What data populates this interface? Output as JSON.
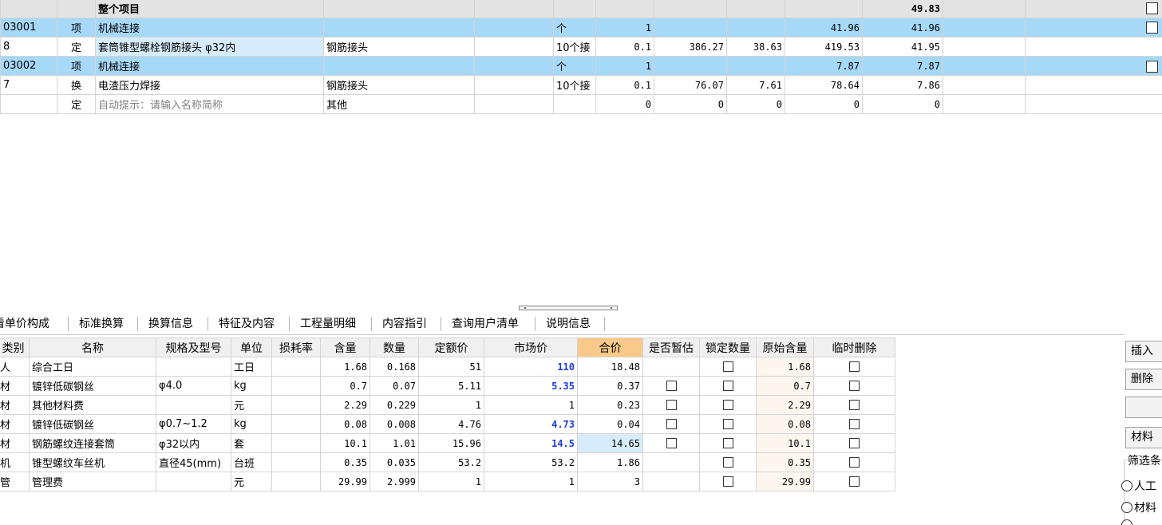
{
  "top": {
    "rows": [
      {
        "code": "",
        "type": "",
        "name": "整个项目",
        "kind": "header",
        "total": "49.83"
      },
      {
        "code": "03001",
        "type": "项",
        "name": "机械连接",
        "kind": "hl",
        "unit": "个",
        "qty": "1",
        "total": "41.96",
        "sum": "41.96"
      },
      {
        "code": "8",
        "type": "定",
        "name": "套筒锥型螺栓钢筋接头 φ32内",
        "spec": "钢筋接头",
        "kind": "plain",
        "unit": "10个接",
        "qty": "0.1",
        "p1": "386.27",
        "p2": "38.63",
        "total": "419.53",
        "sum": "41.95"
      },
      {
        "code": "03002",
        "type": "项",
        "name": "机械连接",
        "kind": "hl",
        "unit": "个",
        "qty": "1",
        "total": "7.87",
        "sum": "7.87"
      },
      {
        "code": "7",
        "type": "换",
        "name": "电渣压力焊接",
        "spec": "钢筋接头",
        "kind": "plain",
        "unit": "10个接",
        "qty": "0.1",
        "p1": "76.07",
        "p2": "7.61",
        "total": "78.64",
        "sum": "7.86"
      },
      {
        "code": "",
        "type": "定",
        "name": "自动提示：请输入名称简称",
        "spec": "其他",
        "kind": "hint",
        "unit": "",
        "qty": "0",
        "p1": "0",
        "p2": "0",
        "total": "0",
        "sum": "0"
      }
    ]
  },
  "tabs": [
    "看单价构成",
    "标准换算",
    "换算信息",
    "特征及内容",
    "工程量明细",
    "内容指引",
    "查询用户清单",
    "说明信息"
  ],
  "bottom": {
    "headers": [
      "类别",
      "名称",
      "规格及型号",
      "单位",
      "损耗率",
      "含量",
      "数量",
      "定额价",
      "市场价",
      "合价",
      "是否暂估",
      "锁定数量",
      "原始含量",
      "临时删除"
    ],
    "rows": [
      {
        "cat": "人",
        "name": "综合工日",
        "spec": "",
        "unit": "工日",
        "loss": "",
        "content": "1.68",
        "qty": "0.168",
        "quota": "51",
        "market": "110",
        "market_blue": true,
        "sum": "18.48",
        "est": false,
        "orig": "1.68"
      },
      {
        "cat": "材",
        "name": "镀锌低碳钢丝",
        "spec": "φ4.0",
        "unit": "kg",
        "loss": "",
        "content": "0.7",
        "qty": "0.07",
        "quota": "5.11",
        "market": "5.35",
        "market_blue": true,
        "sum": "0.37",
        "est": true,
        "orig": "0.7"
      },
      {
        "cat": "材",
        "name": "其他材料费",
        "spec": "",
        "unit": "元",
        "loss": "",
        "content": "2.29",
        "qty": "0.229",
        "quota": "1",
        "market": "1",
        "market_blue": false,
        "sum": "0.23",
        "est": true,
        "orig": "2.29"
      },
      {
        "cat": "材",
        "name": "镀锌低碳钢丝",
        "spec": "φ0.7~1.2",
        "unit": "kg",
        "loss": "",
        "content": "0.08",
        "qty": "0.008",
        "quota": "4.76",
        "market": "4.73",
        "market_blue": true,
        "sum": "0.04",
        "est": true,
        "orig": "0.08"
      },
      {
        "cat": "材",
        "name": "钢筋螺纹连接套筒",
        "spec": "φ32以内",
        "unit": "套",
        "loss": "",
        "content": "10.1",
        "qty": "1.01",
        "quota": "15.96",
        "market": "14.5",
        "market_blue": true,
        "sum": "14.65",
        "est": true,
        "orig": "10.1",
        "selected": true
      },
      {
        "cat": "机",
        "name": "锥型螺纹车丝机",
        "spec": "直径45(mm)",
        "unit": "台班",
        "loss": "",
        "content": "0.35",
        "qty": "0.035",
        "quota": "53.2",
        "market": "53.2",
        "market_blue": false,
        "sum": "1.86",
        "est": false,
        "orig": "0.35"
      },
      {
        "cat": "管",
        "name": "管理费",
        "spec": "",
        "unit": "元",
        "loss": "",
        "content": "29.99",
        "qty": "2.999",
        "quota": "1",
        "market": "1",
        "market_blue": false,
        "sum": "3",
        "est": false,
        "orig": "29.99"
      }
    ]
  },
  "right": {
    "insert": "插入",
    "delete": "删除",
    "blank": "",
    "material": "材料",
    "filter": "筛选条",
    "radio1": "人工",
    "radio2": "材料"
  }
}
